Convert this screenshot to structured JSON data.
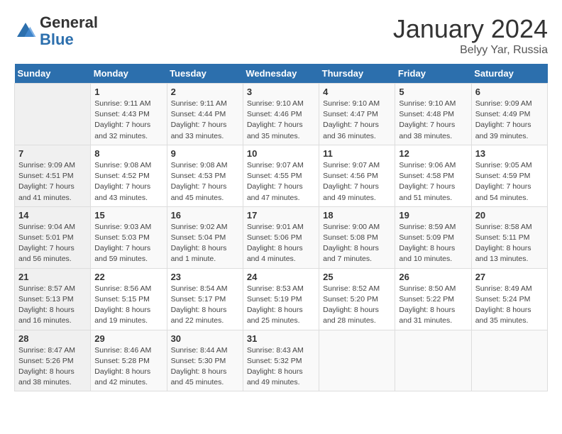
{
  "header": {
    "logo_general": "General",
    "logo_blue": "Blue",
    "title": "January 2024",
    "subtitle": "Belyy Yar, Russia"
  },
  "days_of_week": [
    "Sunday",
    "Monday",
    "Tuesday",
    "Wednesday",
    "Thursday",
    "Friday",
    "Saturday"
  ],
  "weeks": [
    [
      {
        "day": "",
        "sunrise": "",
        "sunset": "",
        "daylight": ""
      },
      {
        "day": "1",
        "sunrise": "Sunrise: 9:11 AM",
        "sunset": "Sunset: 4:43 PM",
        "daylight": "Daylight: 7 hours and 32 minutes."
      },
      {
        "day": "2",
        "sunrise": "Sunrise: 9:11 AM",
        "sunset": "Sunset: 4:44 PM",
        "daylight": "Daylight: 7 hours and 33 minutes."
      },
      {
        "day": "3",
        "sunrise": "Sunrise: 9:10 AM",
        "sunset": "Sunset: 4:46 PM",
        "daylight": "Daylight: 7 hours and 35 minutes."
      },
      {
        "day": "4",
        "sunrise": "Sunrise: 9:10 AM",
        "sunset": "Sunset: 4:47 PM",
        "daylight": "Daylight: 7 hours and 36 minutes."
      },
      {
        "day": "5",
        "sunrise": "Sunrise: 9:10 AM",
        "sunset": "Sunset: 4:48 PM",
        "daylight": "Daylight: 7 hours and 38 minutes."
      },
      {
        "day": "6",
        "sunrise": "Sunrise: 9:09 AM",
        "sunset": "Sunset: 4:49 PM",
        "daylight": "Daylight: 7 hours and 39 minutes."
      }
    ],
    [
      {
        "day": "7",
        "sunrise": "Sunrise: 9:09 AM",
        "sunset": "Sunset: 4:51 PM",
        "daylight": "Daylight: 7 hours and 41 minutes."
      },
      {
        "day": "8",
        "sunrise": "Sunrise: 9:08 AM",
        "sunset": "Sunset: 4:52 PM",
        "daylight": "Daylight: 7 hours and 43 minutes."
      },
      {
        "day": "9",
        "sunrise": "Sunrise: 9:08 AM",
        "sunset": "Sunset: 4:53 PM",
        "daylight": "Daylight: 7 hours and 45 minutes."
      },
      {
        "day": "10",
        "sunrise": "Sunrise: 9:07 AM",
        "sunset": "Sunset: 4:55 PM",
        "daylight": "Daylight: 7 hours and 47 minutes."
      },
      {
        "day": "11",
        "sunrise": "Sunrise: 9:07 AM",
        "sunset": "Sunset: 4:56 PM",
        "daylight": "Daylight: 7 hours and 49 minutes."
      },
      {
        "day": "12",
        "sunrise": "Sunrise: 9:06 AM",
        "sunset": "Sunset: 4:58 PM",
        "daylight": "Daylight: 7 hours and 51 minutes."
      },
      {
        "day": "13",
        "sunrise": "Sunrise: 9:05 AM",
        "sunset": "Sunset: 4:59 PM",
        "daylight": "Daylight: 7 hours and 54 minutes."
      }
    ],
    [
      {
        "day": "14",
        "sunrise": "Sunrise: 9:04 AM",
        "sunset": "Sunset: 5:01 PM",
        "daylight": "Daylight: 7 hours and 56 minutes."
      },
      {
        "day": "15",
        "sunrise": "Sunrise: 9:03 AM",
        "sunset": "Sunset: 5:03 PM",
        "daylight": "Daylight: 7 hours and 59 minutes."
      },
      {
        "day": "16",
        "sunrise": "Sunrise: 9:02 AM",
        "sunset": "Sunset: 5:04 PM",
        "daylight": "Daylight: 8 hours and 1 minute."
      },
      {
        "day": "17",
        "sunrise": "Sunrise: 9:01 AM",
        "sunset": "Sunset: 5:06 PM",
        "daylight": "Daylight: 8 hours and 4 minutes."
      },
      {
        "day": "18",
        "sunrise": "Sunrise: 9:00 AM",
        "sunset": "Sunset: 5:08 PM",
        "daylight": "Daylight: 8 hours and 7 minutes."
      },
      {
        "day": "19",
        "sunrise": "Sunrise: 8:59 AM",
        "sunset": "Sunset: 5:09 PM",
        "daylight": "Daylight: 8 hours and 10 minutes."
      },
      {
        "day": "20",
        "sunrise": "Sunrise: 8:58 AM",
        "sunset": "Sunset: 5:11 PM",
        "daylight": "Daylight: 8 hours and 13 minutes."
      }
    ],
    [
      {
        "day": "21",
        "sunrise": "Sunrise: 8:57 AM",
        "sunset": "Sunset: 5:13 PM",
        "daylight": "Daylight: 8 hours and 16 minutes."
      },
      {
        "day": "22",
        "sunrise": "Sunrise: 8:56 AM",
        "sunset": "Sunset: 5:15 PM",
        "daylight": "Daylight: 8 hours and 19 minutes."
      },
      {
        "day": "23",
        "sunrise": "Sunrise: 8:54 AM",
        "sunset": "Sunset: 5:17 PM",
        "daylight": "Daylight: 8 hours and 22 minutes."
      },
      {
        "day": "24",
        "sunrise": "Sunrise: 8:53 AM",
        "sunset": "Sunset: 5:19 PM",
        "daylight": "Daylight: 8 hours and 25 minutes."
      },
      {
        "day": "25",
        "sunrise": "Sunrise: 8:52 AM",
        "sunset": "Sunset: 5:20 PM",
        "daylight": "Daylight: 8 hours and 28 minutes."
      },
      {
        "day": "26",
        "sunrise": "Sunrise: 8:50 AM",
        "sunset": "Sunset: 5:22 PM",
        "daylight": "Daylight: 8 hours and 31 minutes."
      },
      {
        "day": "27",
        "sunrise": "Sunrise: 8:49 AM",
        "sunset": "Sunset: 5:24 PM",
        "daylight": "Daylight: 8 hours and 35 minutes."
      }
    ],
    [
      {
        "day": "28",
        "sunrise": "Sunrise: 8:47 AM",
        "sunset": "Sunset: 5:26 PM",
        "daylight": "Daylight: 8 hours and 38 minutes."
      },
      {
        "day": "29",
        "sunrise": "Sunrise: 8:46 AM",
        "sunset": "Sunset: 5:28 PM",
        "daylight": "Daylight: 8 hours and 42 minutes."
      },
      {
        "day": "30",
        "sunrise": "Sunrise: 8:44 AM",
        "sunset": "Sunset: 5:30 PM",
        "daylight": "Daylight: 8 hours and 45 minutes."
      },
      {
        "day": "31",
        "sunrise": "Sunrise: 8:43 AM",
        "sunset": "Sunset: 5:32 PM",
        "daylight": "Daylight: 8 hours and 49 minutes."
      },
      {
        "day": "",
        "sunrise": "",
        "sunset": "",
        "daylight": ""
      },
      {
        "day": "",
        "sunrise": "",
        "sunset": "",
        "daylight": ""
      },
      {
        "day": "",
        "sunrise": "",
        "sunset": "",
        "daylight": ""
      }
    ]
  ]
}
